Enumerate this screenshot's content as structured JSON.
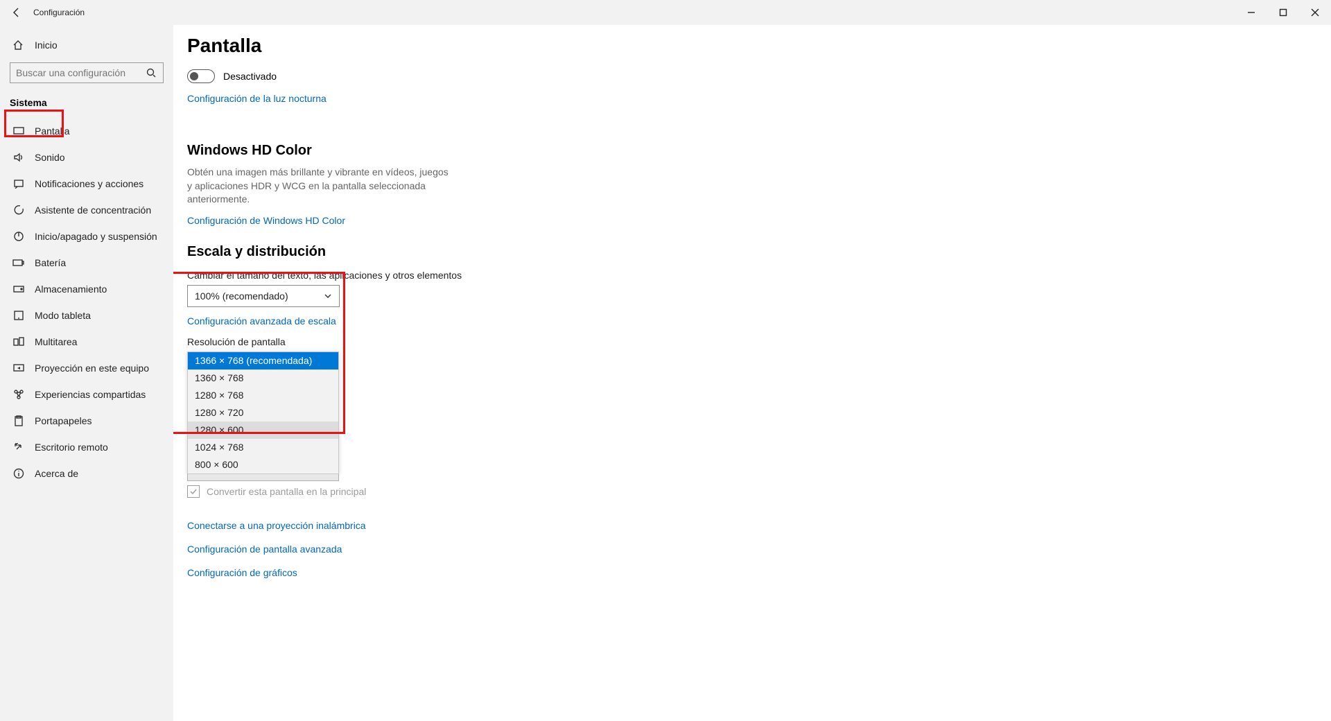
{
  "titlebar": {
    "title": "Configuración"
  },
  "sidebar": {
    "home": "Inicio",
    "search_placeholder": "Buscar una configuración",
    "section": "Sistema",
    "items": [
      "Pantalla",
      "Sonido",
      "Notificaciones y acciones",
      "Asistente de concentración",
      "Inicio/apagado y suspensión",
      "Batería",
      "Almacenamiento",
      "Modo tableta",
      "Multitarea",
      "Proyección en este equipo",
      "Experiencias compartidas",
      "Portapapeles",
      "Escritorio remoto",
      "Acerca de"
    ]
  },
  "content": {
    "page_title": "Pantalla",
    "toggle_label": "Desactivado",
    "night_link": "Configuración de la luz nocturna",
    "hd_title": "Windows HD Color",
    "hd_desc": "Obtén una imagen más brillante y vibrante en vídeos, juegos y aplicaciones HDR y WCG en la pantalla seleccionada anteriormente.",
    "hd_link": "Configuración de Windows HD Color",
    "scale_title": "Escala y distribución",
    "scale_label": "Cambiar el tamaño del texto, las aplicaciones y otros elementos",
    "scale_value": "100% (recomendado)",
    "scale_link": "Configuración avanzada de escala",
    "res_label": "Resolución de pantalla",
    "res_options": [
      "1366 × 768 (recomendada)",
      "1360 × 768",
      "1280 × 768",
      "1280 × 720",
      "1280 × 600",
      "1024 × 768",
      "800 × 600"
    ],
    "main_checkbox": "Convertir esta pantalla en la principal",
    "links_bottom": [
      "Conectarse a una proyección inalámbrica",
      "Configuración de pantalla avanzada",
      "Configuración de gráficos"
    ]
  }
}
